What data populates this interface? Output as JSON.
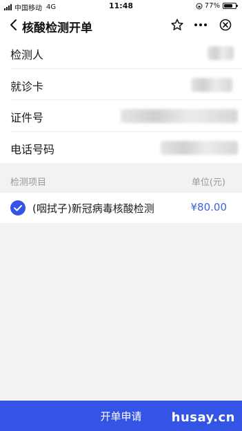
{
  "status_bar": {
    "carrier": "中国移动",
    "network": "4G",
    "time": "11:48",
    "battery": "77%",
    "battery_level": 0.77
  },
  "nav": {
    "title": "核酸检测开单",
    "back_icon": "chevron-left-icon",
    "star_icon": "star-icon",
    "more_icon": "more-dots-icon",
    "close_icon": "close-circle-icon"
  },
  "form": {
    "rows": [
      {
        "label": "检测人"
      },
      {
        "label": "就诊卡"
      },
      {
        "label": "证件号"
      },
      {
        "label": "电话号码"
      }
    ]
  },
  "items": {
    "header_left": "检测项目",
    "header_right": "单位(元)",
    "list": [
      {
        "name": "(咽拭子)新冠病毒核酸检测",
        "price": "¥80.00",
        "checked": true
      }
    ]
  },
  "footer": {
    "submit_label": "开单申请",
    "watermark": "husay.cn"
  },
  "colors": {
    "accent": "#3454e6",
    "price": "#3b63e0",
    "background": "#f2f2f2"
  }
}
